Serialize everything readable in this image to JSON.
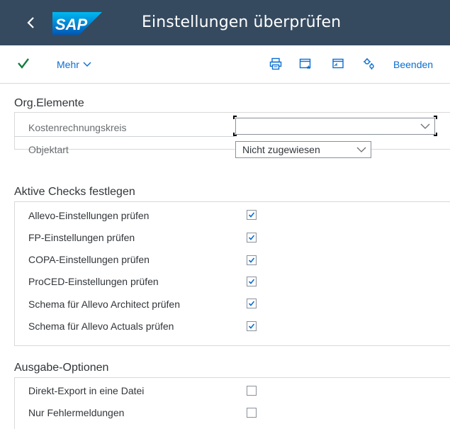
{
  "header": {
    "title": "Einstellungen überprüfen",
    "logo_text": "SAP"
  },
  "toolbar": {
    "more_label": "Mehr",
    "exit_label": "Beenden"
  },
  "org_elements": {
    "title": "Org.Elemente",
    "fields": [
      {
        "label": "Kostenrechnungskreis",
        "value": ""
      },
      {
        "label": "Objektart",
        "value": "Nicht zugewiesen"
      }
    ]
  },
  "active_checks": {
    "title": "Aktive Checks festlegen",
    "items": [
      {
        "label": "Allevo-Einstellungen prüfen",
        "checked": true
      },
      {
        "label": "FP-Einstellungen prüfen",
        "checked": true
      },
      {
        "label": "COPA-Einstellungen prüfen",
        "checked": true
      },
      {
        "label": "ProCED-Einstellungen prüfen",
        "checked": true
      },
      {
        "label": "Schema für Allevo Architect prüfen",
        "checked": true
      },
      {
        "label": "Schema für Allevo Actuals prüfen",
        "checked": true
      }
    ]
  },
  "output_options": {
    "title": "Ausgabe-Optionen",
    "items": [
      {
        "label": "Direkt-Export in eine Datei",
        "checked": false
      },
      {
        "label": "Nur Fehlermeldungen",
        "checked": false
      }
    ]
  },
  "colors": {
    "shell": "#354a5f",
    "accent": "#0a6ed1",
    "check_green": "#107e3e"
  }
}
